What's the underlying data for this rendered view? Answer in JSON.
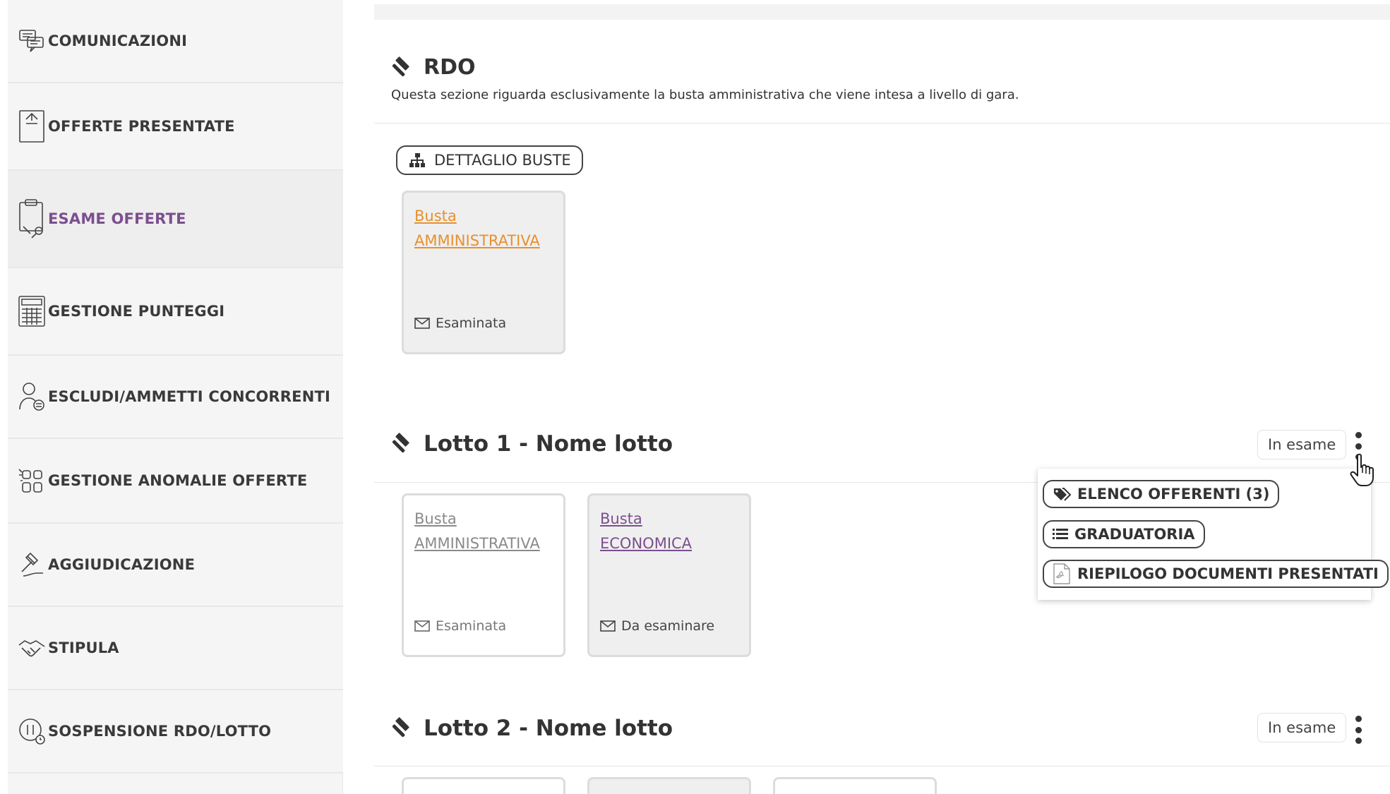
{
  "sidebar": {
    "items": [
      {
        "label": "COMUNICAZIONI",
        "icon": "chat-bubbles-icon"
      },
      {
        "label": "OFFERTE PRESENTATE",
        "icon": "document-stamp-icon"
      },
      {
        "label": "ESAME OFFERTE",
        "icon": "clipboard-magnifier-icon",
        "active": true
      },
      {
        "label": "GESTIONE PUNTEGGI",
        "icon": "calculator-icon"
      },
      {
        "label": "ESCLUDI/AMMETTI CONCORRENTI",
        "icon": "user-exclude-icon"
      },
      {
        "label": "GESTIONE ANOMALIE OFFERTE",
        "icon": "anomaly-grid-icon"
      },
      {
        "label": "AGGIUDICAZIONE",
        "icon": "gavel-hand-icon"
      },
      {
        "label": "STIPULA",
        "icon": "handshake-icon"
      },
      {
        "label": "SOSPENSIONE RDO/LOTTO",
        "icon": "pause-clock-icon"
      }
    ]
  },
  "rdo": {
    "title": "RDO",
    "description": "Questa sezione riguarda esclusivamente la busta amministrativa che viene intesa a livello di gara.",
    "detail_button": "DETTAGLIO BUSTE",
    "card": {
      "line1": "Busta",
      "line2": "AMMINISTRATIVA",
      "status": "Esaminata"
    }
  },
  "lotto1": {
    "title": "Lotto 1 - Nome lotto",
    "status": "In esame",
    "cards": [
      {
        "line1": "Busta",
        "line2": "AMMINISTRATIVA",
        "status": "Esaminata"
      },
      {
        "line1": "Busta",
        "line2": "ECONOMICA",
        "status": "Da esaminare"
      }
    ],
    "menu": [
      {
        "label": "ELENCO OFFERENTI (3)",
        "icon": "tags-icon"
      },
      {
        "label": "GRADUATORIA",
        "icon": "list-icon"
      },
      {
        "label": "RIEPILOGO DOCUMENTI PRESENTATI",
        "icon": "pdf-file-icon"
      }
    ]
  },
  "lotto2": {
    "title": "Lotto 2 - Nome lotto",
    "status": "In esame"
  },
  "colors": {
    "active": "#7b4f8e",
    "orange_link": "#e8902e",
    "purple_link": "#7b4f8e"
  }
}
